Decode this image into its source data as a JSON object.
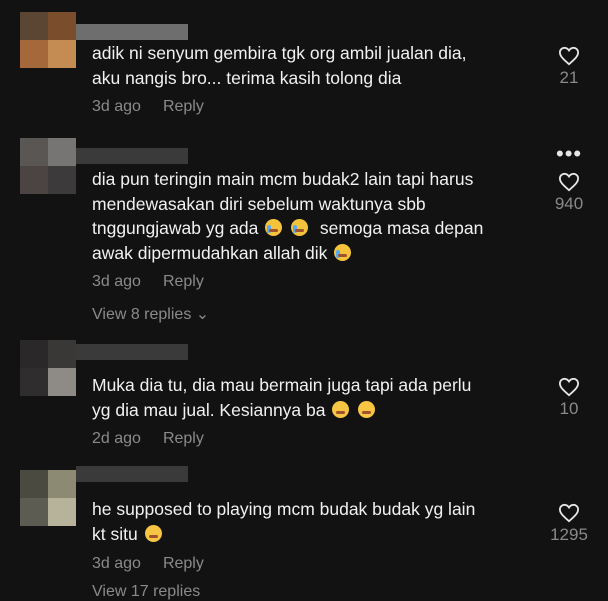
{
  "comments": [
    {
      "text_lines": [
        "adik ni senyum gembira tgk org ambil jualan dia,",
        "aku nangis bro... terima kasih tolong dia"
      ],
      "time": "3d ago",
      "reply": "Reply",
      "likes": "21"
    },
    {
      "text_lines": [
        "dia pun teringin main mcm budak2 lain tapi harus",
        "mendewasakan diri sebelum waktunya sbb",
        "tnggungjawab yg ada",
        "semoga masa depan",
        "awak dipermudahkan allah dik"
      ],
      "time": "3d ago",
      "reply": "Reply",
      "likes": "940",
      "more": "•••",
      "view_replies": "View 8 replies"
    },
    {
      "text_lines": [
        "Muka dia tu, dia mau bermain juga tapi ada perlu",
        "yg dia mau jual. Kesiannya ba"
      ],
      "time": "2d ago",
      "reply": "Reply",
      "likes": "10"
    },
    {
      "text_lines": [
        "he supposed to playing mcm budak budak yg lain",
        "kt situ"
      ],
      "time": "3d ago",
      "reply": "Reply",
      "likes": "1295",
      "view_replies": "View 17 replies"
    }
  ],
  "colors": {
    "background": "#121212",
    "text": "#f1f1f1",
    "muted": "#8a8a8a"
  }
}
